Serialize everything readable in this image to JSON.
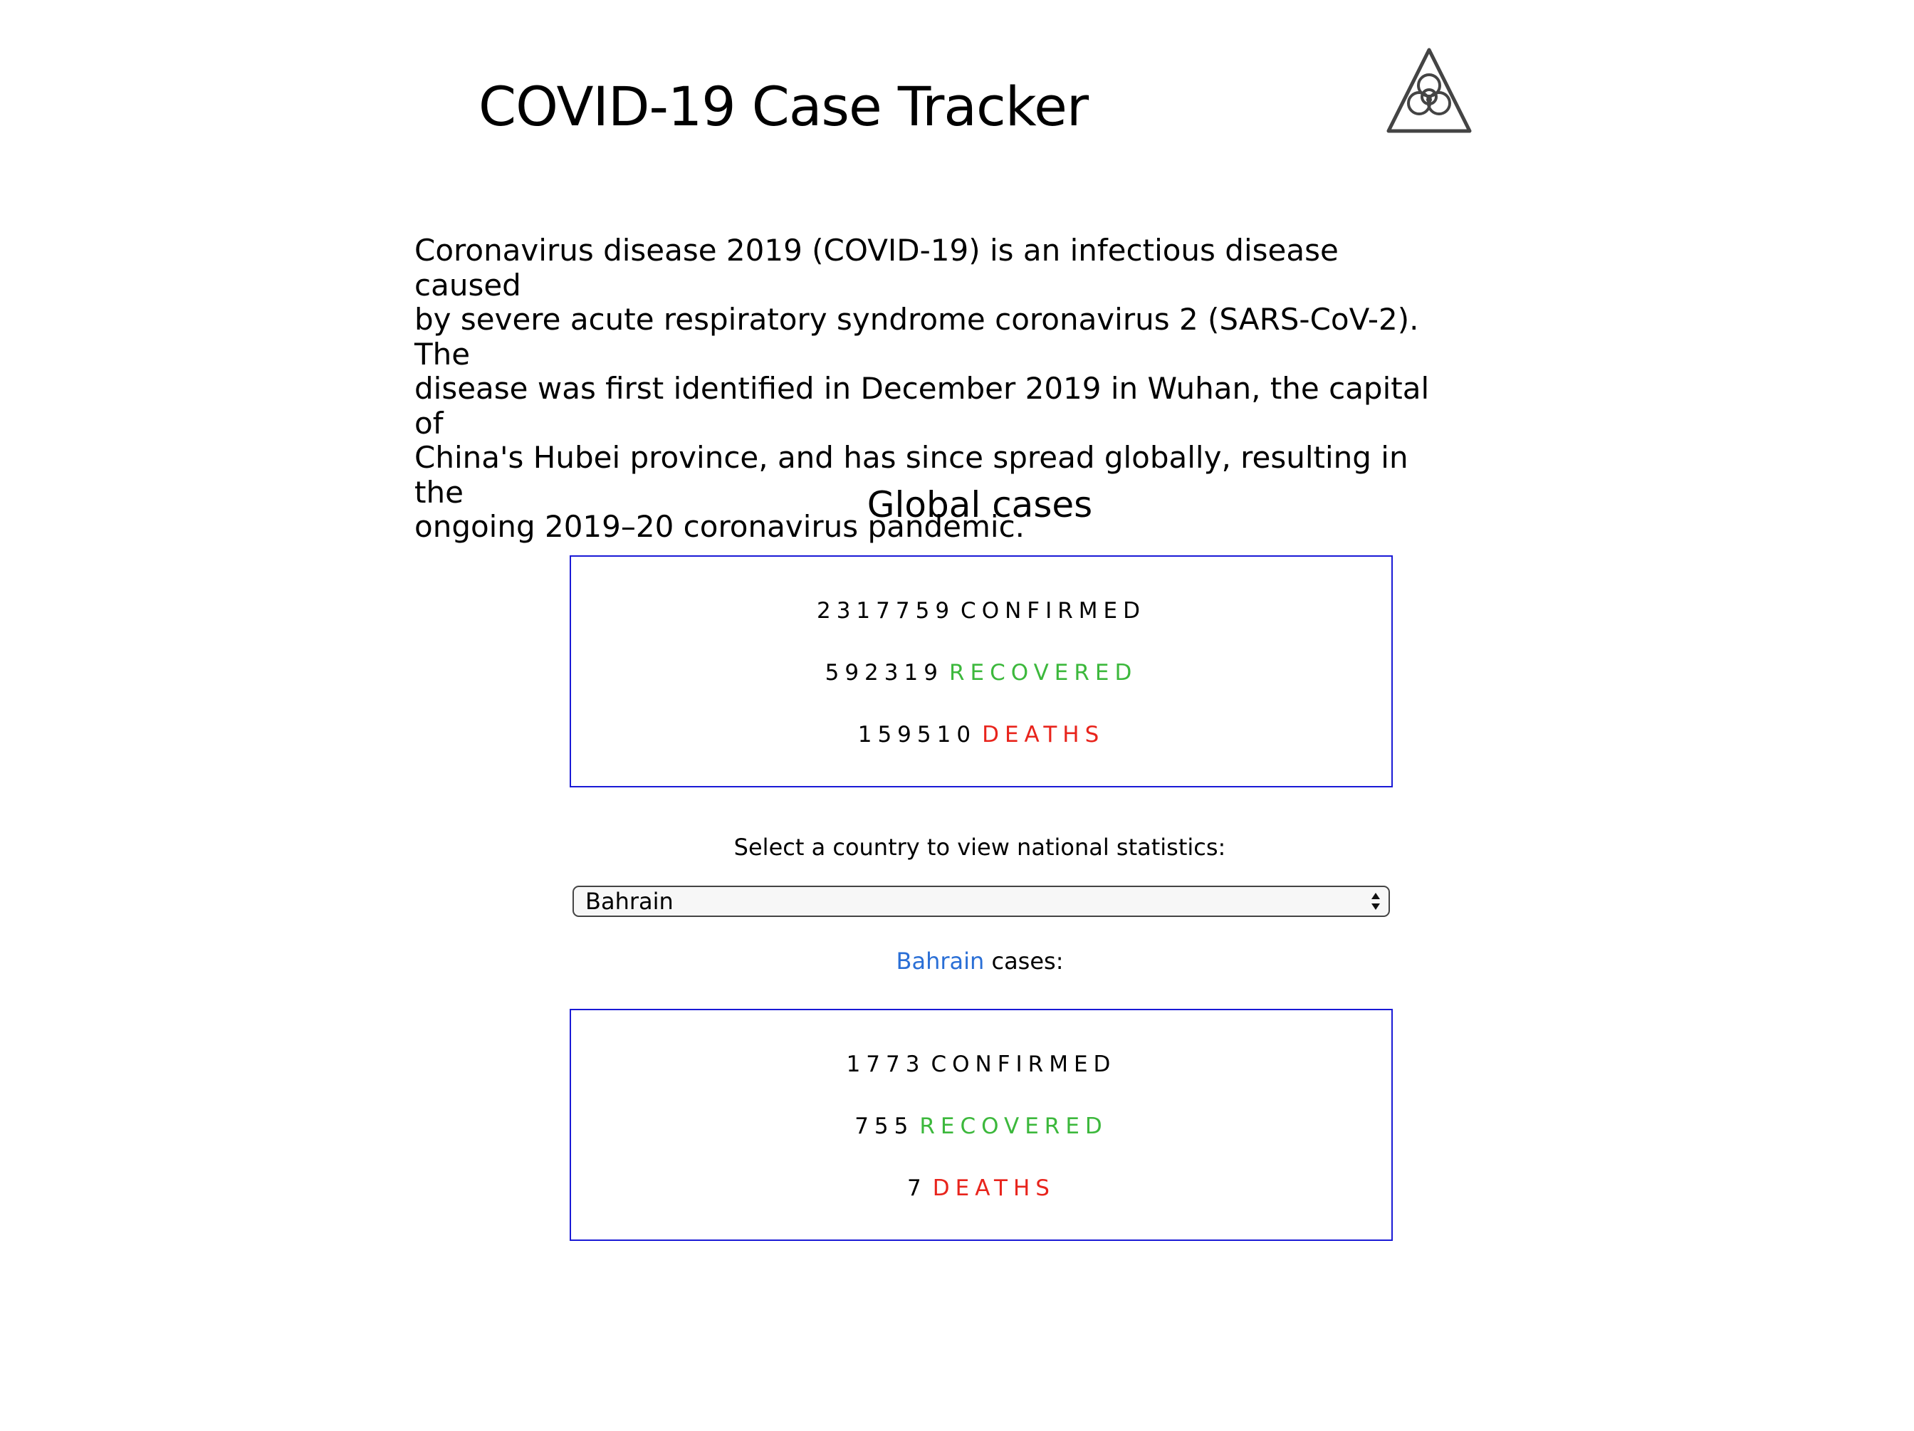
{
  "header": {
    "title": "COVID-19 Case Tracker",
    "logo_icon": "biohazard-icon"
  },
  "intro": {
    "text": "Coronavirus disease 2019 (COVID-19) is an infectious disease caused\nby severe acute respiratory syndrome coronavirus 2 (SARS-CoV-2). The\ndisease was first identified in December 2019 in Wuhan, the capital of\nChina's Hubei province, and has since spread globally, resulting in the\nongoing 2019–20 coronavirus pandemic."
  },
  "global": {
    "heading": "Global cases",
    "confirmed": "2317759",
    "recovered": "592319",
    "deaths": "159510"
  },
  "labels": {
    "confirmed": "CONFIRMED",
    "recovered": "RECOVERED",
    "deaths": "DEATHS"
  },
  "country_select": {
    "prompt": "Select a country to view national statistics:",
    "selected": "Bahrain"
  },
  "country": {
    "name": "Bahrain",
    "caption_suffix": " cases:",
    "confirmed": "1773",
    "recovered": "755",
    "deaths": "7"
  },
  "colors": {
    "box_border": "#1a1ad6",
    "recovered": "#3cb83c",
    "deaths": "#e8241c",
    "country_link": "#2a6fd6"
  }
}
